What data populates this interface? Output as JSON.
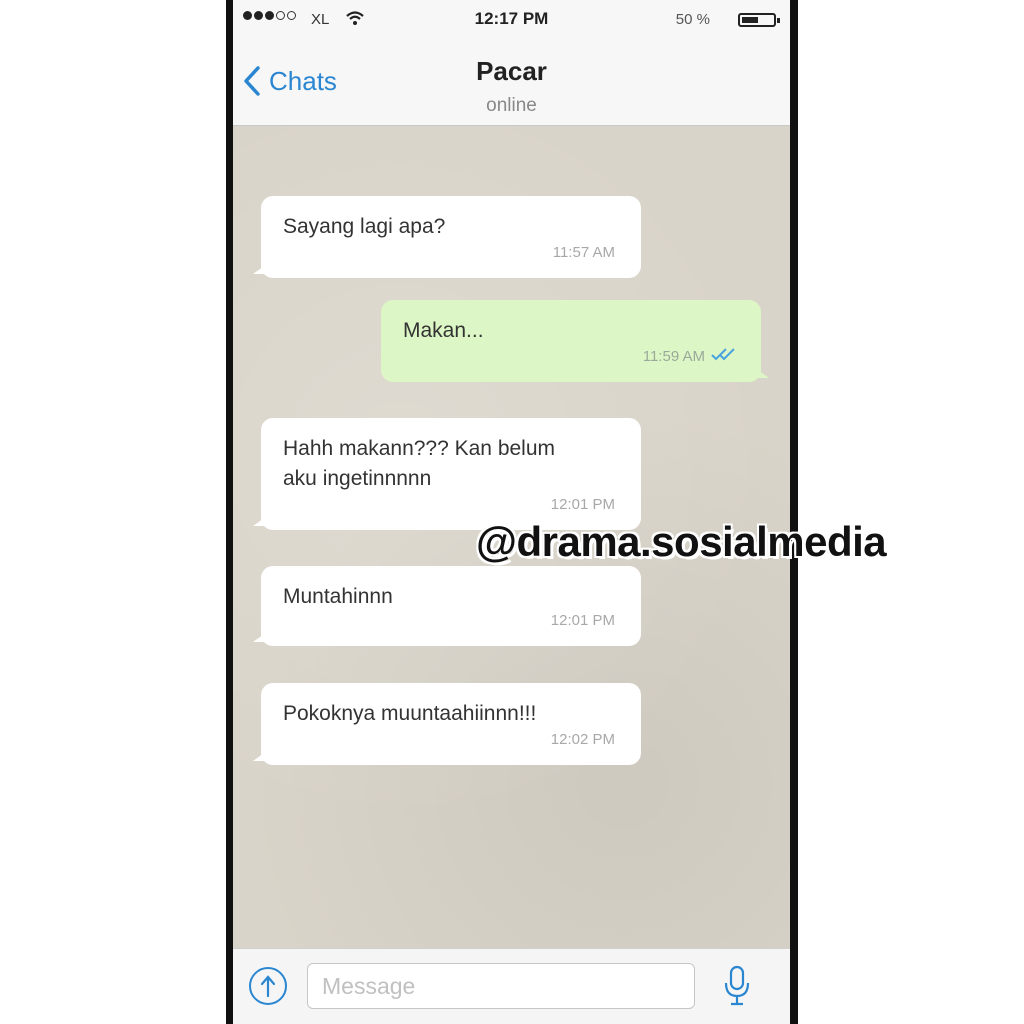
{
  "status_bar": {
    "carrier": "XL",
    "time": "12:17 PM",
    "battery": "50 %",
    "battery_level": 0.5
  },
  "header": {
    "back_label": "Chats",
    "contact_name": "Pacar",
    "contact_status": "online"
  },
  "messages": [
    {
      "direction": "in",
      "lines": [
        "Sayang lagi apa?"
      ],
      "time": "11:57 AM"
    },
    {
      "direction": "out",
      "lines": [
        "Makan..."
      ],
      "time": "11:59 AM",
      "read": true
    },
    {
      "direction": "in",
      "lines": [
        "Hahh makann??? Kan belum",
        "aku ingetinnnnn"
      ],
      "time": "12:01 PM"
    },
    {
      "direction": "in",
      "lines": [
        "Muntahinnn"
      ],
      "time": "12:01 PM"
    },
    {
      "direction": "in",
      "lines": [
        "Pokoknya muuntaahiinnn!!!"
      ],
      "time": "12:02 PM"
    }
  ],
  "watermark": "@drama.sosialmedia",
  "input": {
    "placeholder": "Message"
  },
  "icons": {
    "back": "chevron-left-icon",
    "upload": "upload-arrow-icon",
    "mic": "microphone-icon",
    "read": "double-check-icon"
  },
  "colors": {
    "accent": "#2a86d1",
    "outgoing_bubble": "#dcf7c5",
    "incoming_bubble": "#ffffff",
    "chat_background": "#d9d4c9"
  }
}
